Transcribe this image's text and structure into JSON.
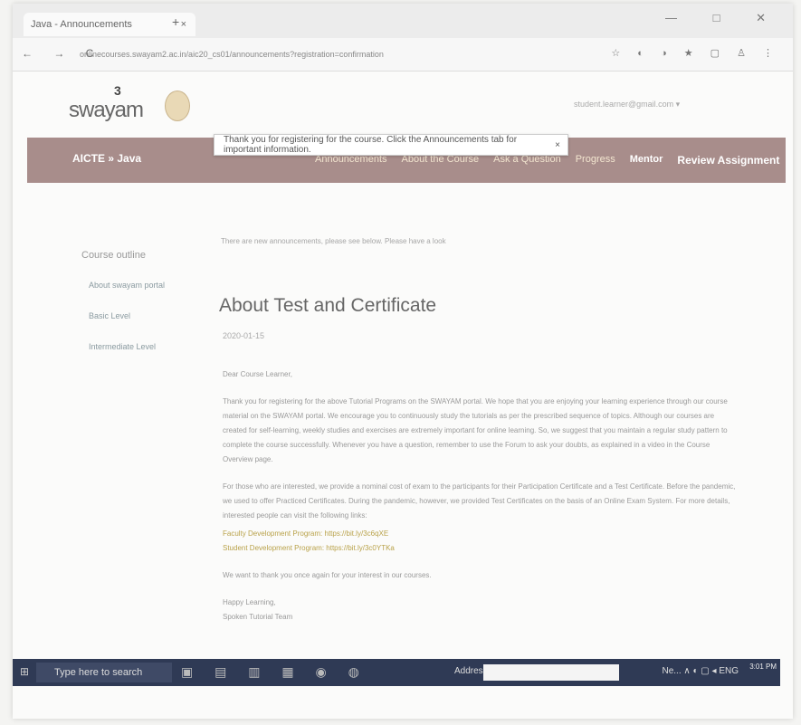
{
  "browser": {
    "tab_title": "Java - Announcements",
    "tab_close": "×",
    "new_tab": "+",
    "window_controls": "— □ ✕",
    "nav_buttons": "← → C",
    "url": "onlinecourses.swayam2.ac.in/aic20_cs01/announcements?registration=confirmation",
    "ext_icons": "☆ ◐ ◑ ★ ▢ ♙ ⋮"
  },
  "header": {
    "logo_text": "swayam",
    "logo_num": "3",
    "user_email": "student.learner@gmail.com ▾"
  },
  "toast": {
    "message": "Thank you for registering for the course. Click the Announcements tab for important information.",
    "close": "×"
  },
  "nav": {
    "breadcrumb": "AICTE » Java",
    "links": [
      "Announcements",
      "About the Course",
      "Ask a Question",
      "Progress",
      "Mentor",
      "Review Assignment"
    ]
  },
  "sidebar": {
    "heading": "Course outline",
    "items": [
      "About swayam portal",
      "Basic Level",
      "Intermediate Level"
    ]
  },
  "content": {
    "notice": "There are new announcements, please see below. Please have a look",
    "title": "About Test and Certificate",
    "date": "2020-01-15",
    "greeting": "Dear Course Learner,",
    "para1": "Thank you for registering for the above Tutorial Programs on the SWAYAM portal. We hope that you are enjoying your learning experience through our course material on the SWAYAM portal. We encourage you to continuously study the tutorials as per the prescribed sequence of topics. Although our courses are created for self-learning, weekly studies and exercises are extremely important for online learning. So, we suggest that you maintain a regular study pattern to complete the course successfully. Whenever you have a question, remember to use the Forum to ask your doubts, as explained in a video in the Course Overview page.",
    "para2": "For those who are interested, we provide a nominal cost of exam to the participants for their Participation Certificate and a Test Certificate. Before the pandemic, we used to offer Practiced Certificates. During the pandemic, however, we provided Test Certificates on the basis of an Online Exam System. For more details, interested people can visit the following links:",
    "link1": "Faculty Development Program: https://bit.ly/3c6qXE",
    "link2": "Student Development Program: https://bit.ly/3c0YTKa",
    "thanks": "We want to thank you once again for your interest in our courses.",
    "signoff1": "Happy Learning,",
    "signoff2": "Spoken Tutorial Team"
  },
  "taskbar": {
    "search_placeholder": "Type here to search",
    "address_label": "Address",
    "tray": "Ne... ∧ ◐ ▢ ◂ ENG",
    "time": "3:01 PM"
  }
}
